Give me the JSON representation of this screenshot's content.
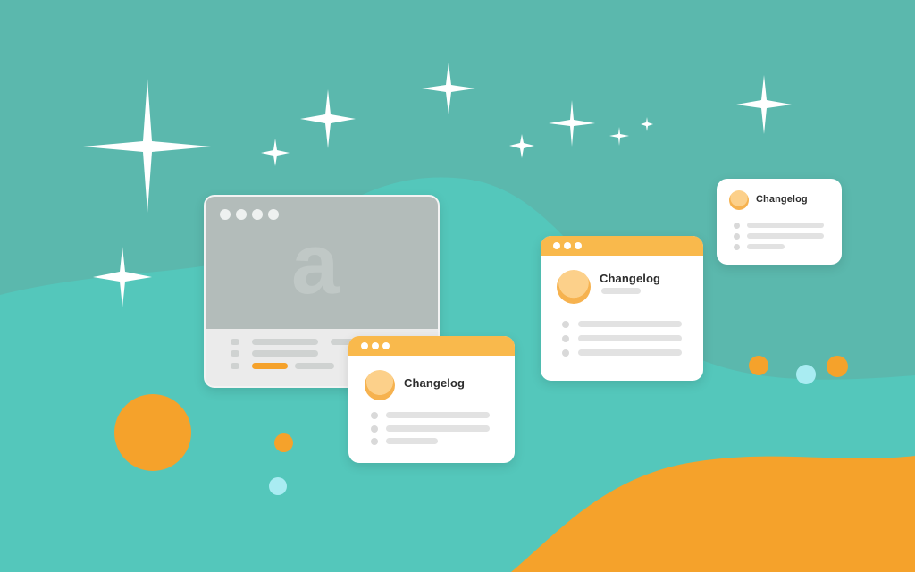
{
  "big_window": {
    "logo_glyph": "a"
  },
  "cards": [
    {
      "title": "Changelog"
    },
    {
      "title": "Changelog"
    },
    {
      "title": "Changelog"
    }
  ],
  "colors": {
    "background": "#5bb8ad",
    "wave": "#54c7bb",
    "accent_orange": "#f5a22b",
    "accent_cyan": "#a9ecf2",
    "titlebar": "#f9b94c"
  },
  "decor": {
    "sparkle_icon": "four-point-star",
    "circles": [
      "orange",
      "cyan"
    ]
  }
}
